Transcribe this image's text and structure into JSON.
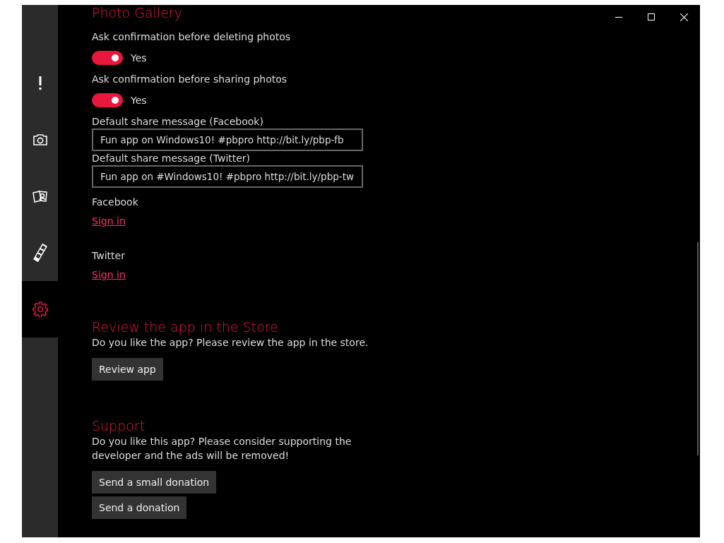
{
  "nav": [
    {
      "kind": "alert",
      "selected": false
    },
    {
      "kind": "camera",
      "selected": false
    },
    {
      "kind": "photos",
      "selected": false
    },
    {
      "kind": "film",
      "selected": false
    },
    {
      "kind": "settings",
      "selected": true
    }
  ],
  "sections": [
    {
      "title": "Photo Gallery",
      "rows": [
        {
          "kind": "label",
          "text": "Ask confirmation before deleting photos"
        },
        {
          "kind": "toggle",
          "on": true,
          "text": "Yes"
        },
        {
          "kind": "label",
          "text": "Ask confirmation before sharing photos"
        },
        {
          "kind": "toggle",
          "on": true,
          "text": "Yes"
        },
        {
          "kind": "label",
          "text": "Default share message (Facebook)"
        },
        {
          "kind": "field",
          "value": "Fun app on Windows10! #pbpro http://bit.ly/pbp-fb"
        },
        {
          "kind": "label",
          "text": "Default share message (Twitter)"
        },
        {
          "kind": "field",
          "value": "Fun app on #Windows10! #pbpro http://bit.ly/pbp-tw"
        },
        {
          "kind": "account",
          "text": "Facebook"
        },
        {
          "kind": "link",
          "text": "Sign in"
        },
        {
          "kind": "account",
          "text": "Twitter"
        },
        {
          "kind": "link",
          "text": "Sign in"
        }
      ]
    },
    {
      "title": "Review the app in the Store",
      "rows": [
        {
          "kind": "paragraph",
          "text": "Do you like the app? Please review the app in the store."
        },
        {
          "kind": "button",
          "text": "Review app"
        }
      ]
    },
    {
      "title": "Support",
      "rows": [
        {
          "kind": "paragraph",
          "text": "Do you like this app? Please consider supporting the developer and the ads will be removed!"
        },
        {
          "kind": "button",
          "text": "Send a small donation"
        },
        {
          "kind": "button",
          "text": "Send a donation"
        }
      ]
    }
  ]
}
